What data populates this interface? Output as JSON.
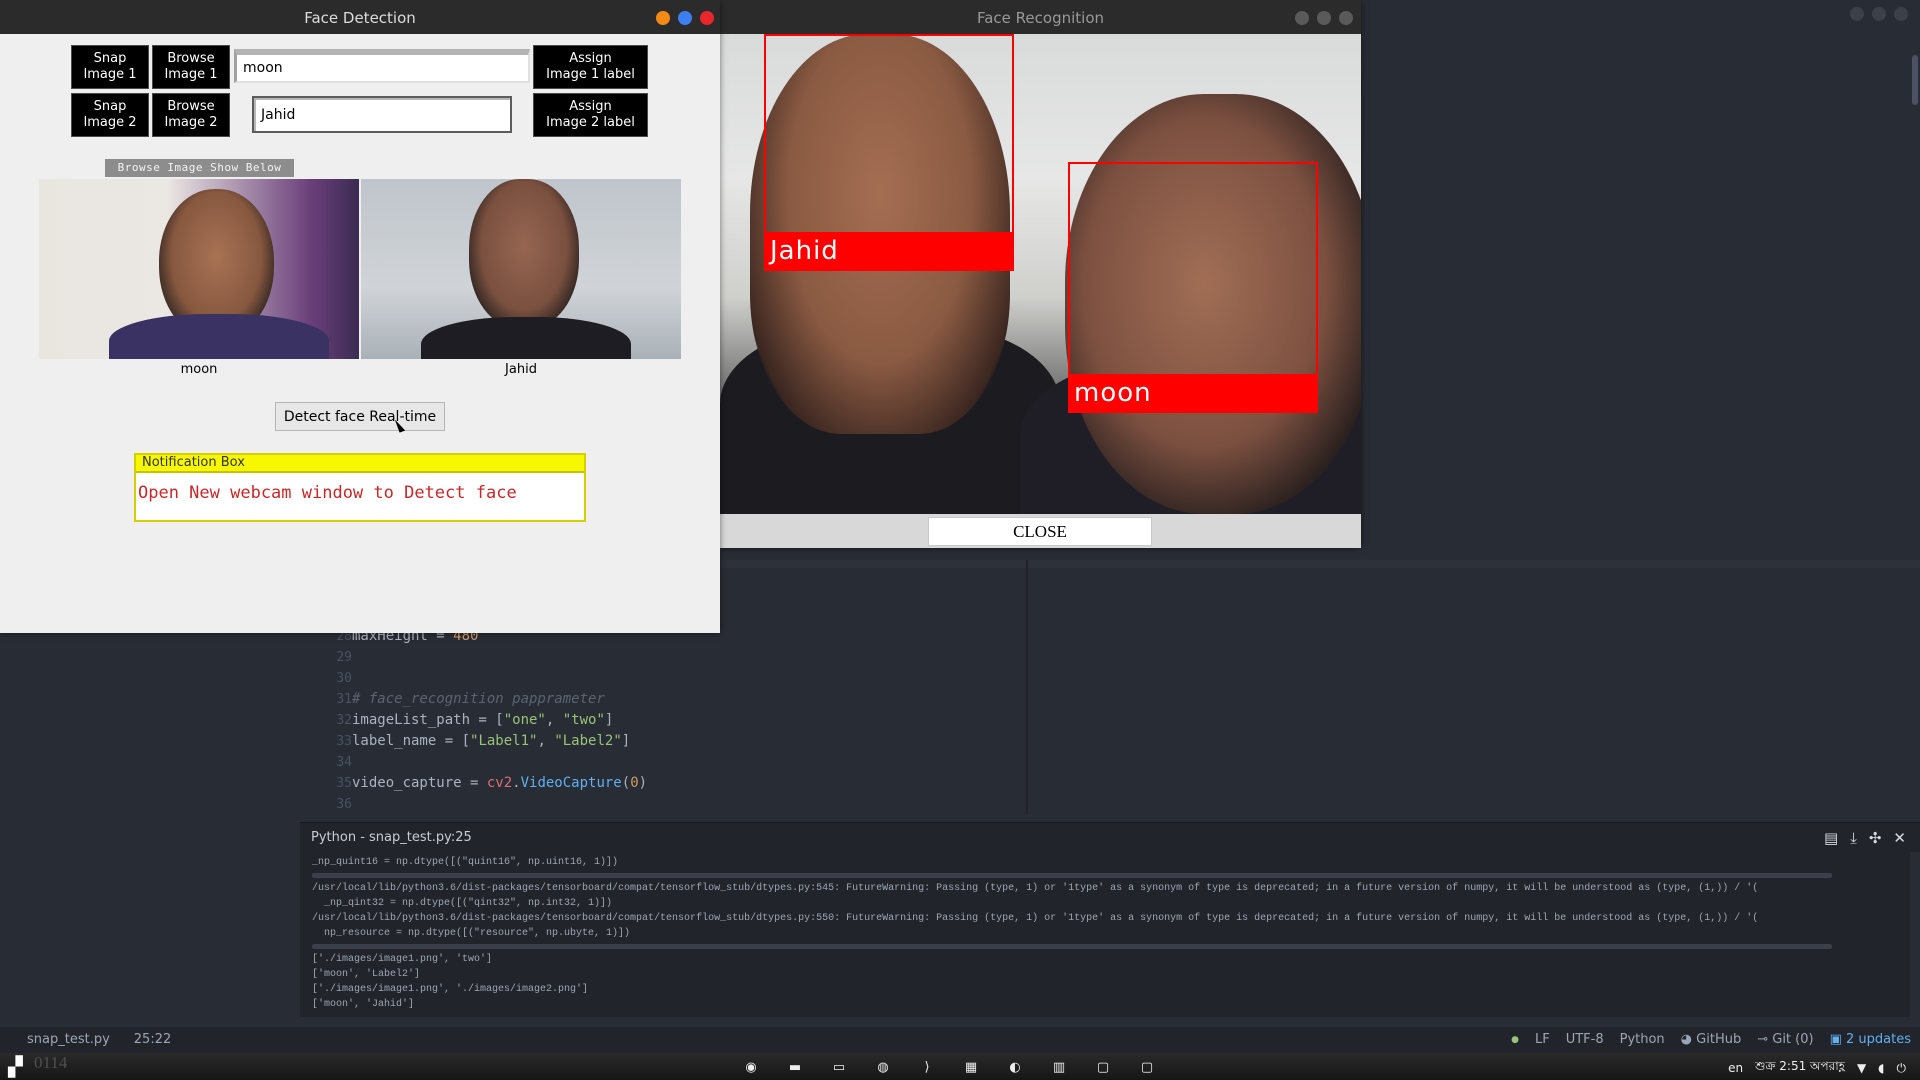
{
  "face_detection": {
    "title": "Face Detection",
    "snap1": "Snap\nImage 1",
    "browse1": "Browse\nImage 1",
    "entry1": "moon",
    "assign1": "Assign\nImage 1 label",
    "snap2": "Snap\nImage 2",
    "browse2": "Browse\nImage 2",
    "entry2": "Jahid",
    "assign2": "Assign\nImage 2 label",
    "browse_show_label": "Browse Image Show Below",
    "image1_caption": "moon",
    "image2_caption": "Jahid",
    "detect_button": "Detect face Real-time",
    "notification_title": "Notification Box",
    "notification_message": "Open New webcam window to Detect face"
  },
  "face_recognition": {
    "title": "Face Recognition",
    "label_a": "Jahid",
    "label_b": "moon",
    "close_button": "CLOSE"
  },
  "editor": {
    "line_numbers": [
      "28",
      "29",
      "30",
      "31",
      "32",
      "33",
      "34",
      "35",
      "36"
    ],
    "line28_var": "maxHeight",
    "line28_op": " = ",
    "line28_val": "480",
    "comment": "# face_recognition papprameter",
    "l32_var": "imageList_path = [",
    "l32_s1": "\"one\"",
    "l32_sep": ", ",
    "l32_s2": "\"two\"",
    "l32_end": "]",
    "l33_var": "label_name = [",
    "l33_s1": "\"Label1\"",
    "l33_sep": ", ",
    "l33_s2": "\"Label2\"",
    "l33_end": "]",
    "l35_var": "video_capture = ",
    "l35_mod": "cv2",
    "l35_dot": ".",
    "l35_fn": "VideoCapture",
    "l35_open": "(",
    "l35_num": "0",
    "l35_close": ")"
  },
  "terminal": {
    "title": "Python - snap_test.py:25",
    "lines": [
      "_np_quint16 = np.dtype([(\"quint16\", np.uint16, 1)])",
      "/usr/local/lib/python3.6/dist-packages/tensorboard/compat/tensorflow_stub/dtypes.py:545: FutureWarning: Passing (type, 1) or '1type' as a synonym of type is deprecated; in a future version of numpy, it will be understood as (type, (1,)) / '(",
      "  _np_qint32 = np.dtype([(\"qint32\", np.int32, 1)])",
      "/usr/local/lib/python3.6/dist-packages/tensorboard/compat/tensorflow_stub/dtypes.py:550: FutureWarning: Passing (type, 1) or '1type' as a synonym of type is deprecated; in a future version of numpy, it will be understood as (type, (1,)) / '(",
      "  np_resource = np.dtype([(\"resource\", np.ubyte, 1)])",
      "['./images/image1.png', 'two']",
      "['moon', 'Label2']",
      "['./images/image1.png', './images/image2.png']",
      "['moon', 'Jahid']"
    ]
  },
  "statusbar": {
    "file": "snap_test.py",
    "position": "25:22",
    "eol": "LF",
    "encoding": "UTF-8",
    "grammar": "Python",
    "github": "GitHub",
    "git": "Git (0)",
    "updates": "2 updates"
  },
  "taskbar": {
    "ghost_text": "0114",
    "lang": "en",
    "clock": "শুক্র 2:51 অপরাহ্ণ"
  },
  "colors": {
    "box_red": "#ff0000",
    "notif_yellow": "#f7f700",
    "notif_text": "#c82828"
  }
}
